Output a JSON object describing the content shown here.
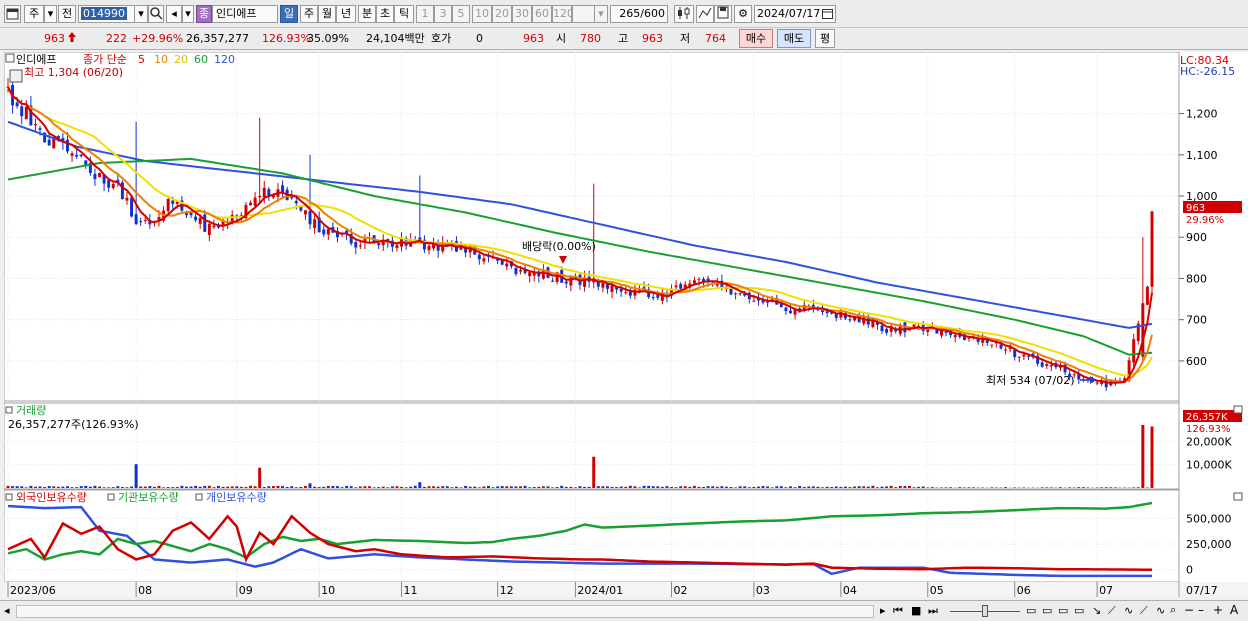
{
  "toolbar": {
    "period_select": "주",
    "prev_label": "전",
    "stock_code": "014990",
    "stock_badge": "종",
    "stock_name": "인디에프",
    "period_tabs": [
      "일",
      "주",
      "월",
      "년",
      "분",
      "초",
      "틱"
    ],
    "active_tab": "일",
    "intervals": [
      "1",
      "3",
      "5",
      "10",
      "20",
      "30",
      "60",
      "120"
    ],
    "view_count": "265",
    "view_total": "/600",
    "date": "2024/07/17"
  },
  "quote": {
    "price": "963",
    "change": "222",
    "change_pct": "+29.96%",
    "volume": "26,357,277",
    "volume_ratio": "126.93%",
    "turnover": "35.09%",
    "amount": "24,104백만",
    "hoga_label": "호가",
    "hoga_value": "0",
    "hoga_price": "963",
    "open_label": "시",
    "open_value": "780",
    "high_label": "고",
    "high_value": "963",
    "low_label": "저",
    "low_value": "764",
    "buy_label": "매수",
    "sell_label": "매도",
    "eval_label": "평"
  },
  "legend": {
    "name": "인디에프",
    "ma_title": "종가 단순",
    "ma_periods": [
      "5",
      "10",
      "20",
      "60",
      "120"
    ],
    "ma_colors": [
      "#d40000",
      "#f08000",
      "#f0e000",
      "#18a030",
      "#3050e0"
    ],
    "high_note": "최고 1,304 (06/20)",
    "low_note": "최저 534 (07/02)",
    "dividend_note": "배당락(0.00%)",
    "lc": "LC:80.34",
    "hc": "HC:-26.15",
    "price_tag": "963",
    "pct_tag": "29.96%"
  },
  "volume_panel": {
    "title": "거래량",
    "value_text": "26,357,277주(126.93%)",
    "tag": "26,357K",
    "tag_pct": "126.93%",
    "axis_ticks": [
      {
        "v": 10000,
        "label": "10,000K"
      },
      {
        "v": 20000,
        "label": "20,000K"
      }
    ]
  },
  "holding_panel": {
    "titles": [
      "외국인보유수량",
      "기관보유수량",
      "개인보유수량"
    ],
    "axis_ticks": [
      {
        "v": 500000,
        "label": "500,000"
      },
      {
        "v": 250000,
        "label": "250,000"
      },
      {
        "v": 0,
        "label": "0"
      }
    ]
  },
  "xaxis": {
    "labels": [
      {
        "i": 0,
        "t": "2023/06"
      },
      {
        "i": 28,
        "t": "08"
      },
      {
        "i": 50,
        "t": "09"
      },
      {
        "i": 68,
        "t": "10"
      },
      {
        "i": 86,
        "t": "11"
      },
      {
        "i": 107,
        "t": "12"
      },
      {
        "i": 124,
        "t": "2024/01"
      },
      {
        "i": 145,
        "t": "02"
      },
      {
        "i": 163,
        "t": "03"
      },
      {
        "i": 182,
        "t": "04"
      },
      {
        "i": 201,
        "t": "05"
      },
      {
        "i": 220,
        "t": "06"
      },
      {
        "i": 238,
        "t": "07"
      }
    ],
    "right_label": "07/17"
  },
  "chart_data": {
    "type": "candlestick",
    "title": "인디에프",
    "yticks": [
      600,
      700,
      800,
      900,
      1000,
      1100,
      1200
    ],
    "ylim": [
      510,
      1330
    ],
    "n_bars": 251,
    "close_anchors": [
      [
        0,
        1250
      ],
      [
        8,
        1150
      ],
      [
        16,
        1080
      ],
      [
        24,
        1020
      ],
      [
        29,
        930
      ],
      [
        36,
        990
      ],
      [
        44,
        920
      ],
      [
        50,
        960
      ],
      [
        56,
        1010
      ],
      [
        62,
        1000
      ],
      [
        68,
        920
      ],
      [
        76,
        890
      ],
      [
        86,
        890
      ],
      [
        96,
        880
      ],
      [
        106,
        840
      ],
      [
        116,
        810
      ],
      [
        122,
        800
      ],
      [
        130,
        790
      ],
      [
        137,
        760
      ],
      [
        145,
        770
      ],
      [
        152,
        790
      ],
      [
        160,
        760
      ],
      [
        170,
        730
      ],
      [
        180,
        715
      ],
      [
        186,
        700
      ],
      [
        192,
        680
      ],
      [
        200,
        680
      ],
      [
        210,
        660
      ],
      [
        220,
        620
      ],
      [
        230,
        580
      ],
      [
        236,
        550
      ],
      [
        240,
        541
      ],
      [
        244,
        550
      ],
      [
        248,
        740
      ],
      [
        249,
        780
      ],
      [
        250,
        963
      ]
    ],
    "ma_anchors": {
      "ma60": [
        [
          0,
          1040
        ],
        [
          20,
          1080
        ],
        [
          40,
          1090
        ],
        [
          60,
          1055
        ],
        [
          80,
          1000
        ],
        [
          100,
          960
        ],
        [
          120,
          910
        ],
        [
          140,
          865
        ],
        [
          160,
          825
        ],
        [
          180,
          785
        ],
        [
          200,
          745
        ],
        [
          220,
          700
        ],
        [
          235,
          660
        ],
        [
          245,
          615
        ],
        [
          250,
          620
        ]
      ],
      "ma120": [
        [
          0,
          1180
        ],
        [
          15,
          1120
        ],
        [
          30,
          1085
        ],
        [
          50,
          1060
        ],
        [
          70,
          1035
        ],
        [
          90,
          1010
        ],
        [
          110,
          980
        ],
        [
          130,
          930
        ],
        [
          150,
          880
        ],
        [
          170,
          840
        ],
        [
          190,
          790
        ],
        [
          210,
          750
        ],
        [
          230,
          710
        ],
        [
          245,
          680
        ],
        [
          250,
          690
        ]
      ]
    },
    "spikes": [
      {
        "i": 28,
        "v": 10200,
        "high": 1180
      },
      {
        "i": 55,
        "v": 8700,
        "high": 1190
      },
      {
        "i": 66,
        "v": 2000,
        "high": 1100
      },
      {
        "i": 90,
        "v": 2500,
        "high": 1050
      },
      {
        "i": 128,
        "v": 13400,
        "high": 1030
      },
      {
        "i": 248,
        "v": 27000,
        "high": 900
      },
      {
        "i": 250,
        "v": 26357,
        "high": 963
      }
    ],
    "volume_unit": "K",
    "volume_ylim": [
      0,
      30000
    ],
    "holdings": {
      "foreign": [
        [
          0,
          200000
        ],
        [
          5,
          300000
        ],
        [
          8,
          120000
        ],
        [
          12,
          450000
        ],
        [
          16,
          350000
        ],
        [
          20,
          420000
        ],
        [
          24,
          200000
        ],
        [
          28,
          100000
        ],
        [
          32,
          150000
        ],
        [
          36,
          380000
        ],
        [
          40,
          460000
        ],
        [
          44,
          300000
        ],
        [
          48,
          520000
        ],
        [
          50,
          420000
        ],
        [
          52,
          100000
        ],
        [
          55,
          360000
        ],
        [
          58,
          250000
        ],
        [
          62,
          520000
        ],
        [
          66,
          360000
        ],
        [
          70,
          250000
        ],
        [
          76,
          180000
        ],
        [
          80,
          200000
        ],
        [
          86,
          150000
        ],
        [
          96,
          120000
        ],
        [
          106,
          130000
        ],
        [
          116,
          110000
        ],
        [
          126,
          100000
        ],
        [
          130,
          100000
        ],
        [
          140,
          80000
        ],
        [
          150,
          70000
        ],
        [
          160,
          60000
        ],
        [
          170,
          50000
        ],
        [
          176,
          60000
        ],
        [
          180,
          20000
        ],
        [
          190,
          10000
        ],
        [
          200,
          5000
        ],
        [
          210,
          20000
        ],
        [
          220,
          15000
        ],
        [
          230,
          5000
        ],
        [
          240,
          3000
        ],
        [
          250,
          0
        ]
      ],
      "institution": [
        [
          0,
          160000
        ],
        [
          4,
          200000
        ],
        [
          8,
          100000
        ],
        [
          12,
          150000
        ],
        [
          16,
          180000
        ],
        [
          20,
          150000
        ],
        [
          24,
          300000
        ],
        [
          28,
          250000
        ],
        [
          32,
          280000
        ],
        [
          36,
          230000
        ],
        [
          40,
          180000
        ],
        [
          44,
          250000
        ],
        [
          48,
          200000
        ],
        [
          52,
          120000
        ],
        [
          56,
          250000
        ],
        [
          60,
          320000
        ],
        [
          64,
          280000
        ],
        [
          68,
          300000
        ],
        [
          72,
          250000
        ],
        [
          80,
          290000
        ],
        [
          90,
          280000
        ],
        [
          100,
          260000
        ],
        [
          106,
          270000
        ],
        [
          110,
          300000
        ],
        [
          116,
          330000
        ],
        [
          122,
          380000
        ],
        [
          126,
          440000
        ],
        [
          130,
          410000
        ],
        [
          140,
          430000
        ],
        [
          150,
          450000
        ],
        [
          160,
          470000
        ],
        [
          170,
          480000
        ],
        [
          180,
          520000
        ],
        [
          190,
          530000
        ],
        [
          200,
          550000
        ],
        [
          210,
          560000
        ],
        [
          220,
          580000
        ],
        [
          230,
          600000
        ],
        [
          240,
          595000
        ],
        [
          245,
          610000
        ],
        [
          250,
          650000
        ]
      ],
      "individual": [
        [
          0,
          620000
        ],
        [
          8,
          600000
        ],
        [
          16,
          610000
        ],
        [
          20,
          380000
        ],
        [
          26,
          330000
        ],
        [
          32,
          100000
        ],
        [
          40,
          70000
        ],
        [
          48,
          100000
        ],
        [
          54,
          30000
        ],
        [
          58,
          70000
        ],
        [
          64,
          200000
        ],
        [
          70,
          110000
        ],
        [
          80,
          150000
        ],
        [
          90,
          120000
        ],
        [
          100,
          100000
        ],
        [
          110,
          80000
        ],
        [
          120,
          70000
        ],
        [
          130,
          60000
        ],
        [
          140,
          60000
        ],
        [
          150,
          60000
        ],
        [
          170,
          50000
        ],
        [
          176,
          55000
        ],
        [
          180,
          -40000
        ],
        [
          186,
          20000
        ],
        [
          200,
          20000
        ],
        [
          206,
          -30000
        ],
        [
          220,
          -50000
        ],
        [
          230,
          -60000
        ],
        [
          240,
          -60000
        ],
        [
          250,
          -60000
        ]
      ]
    },
    "holding_ylim": [
      -100000,
      640000
    ]
  }
}
